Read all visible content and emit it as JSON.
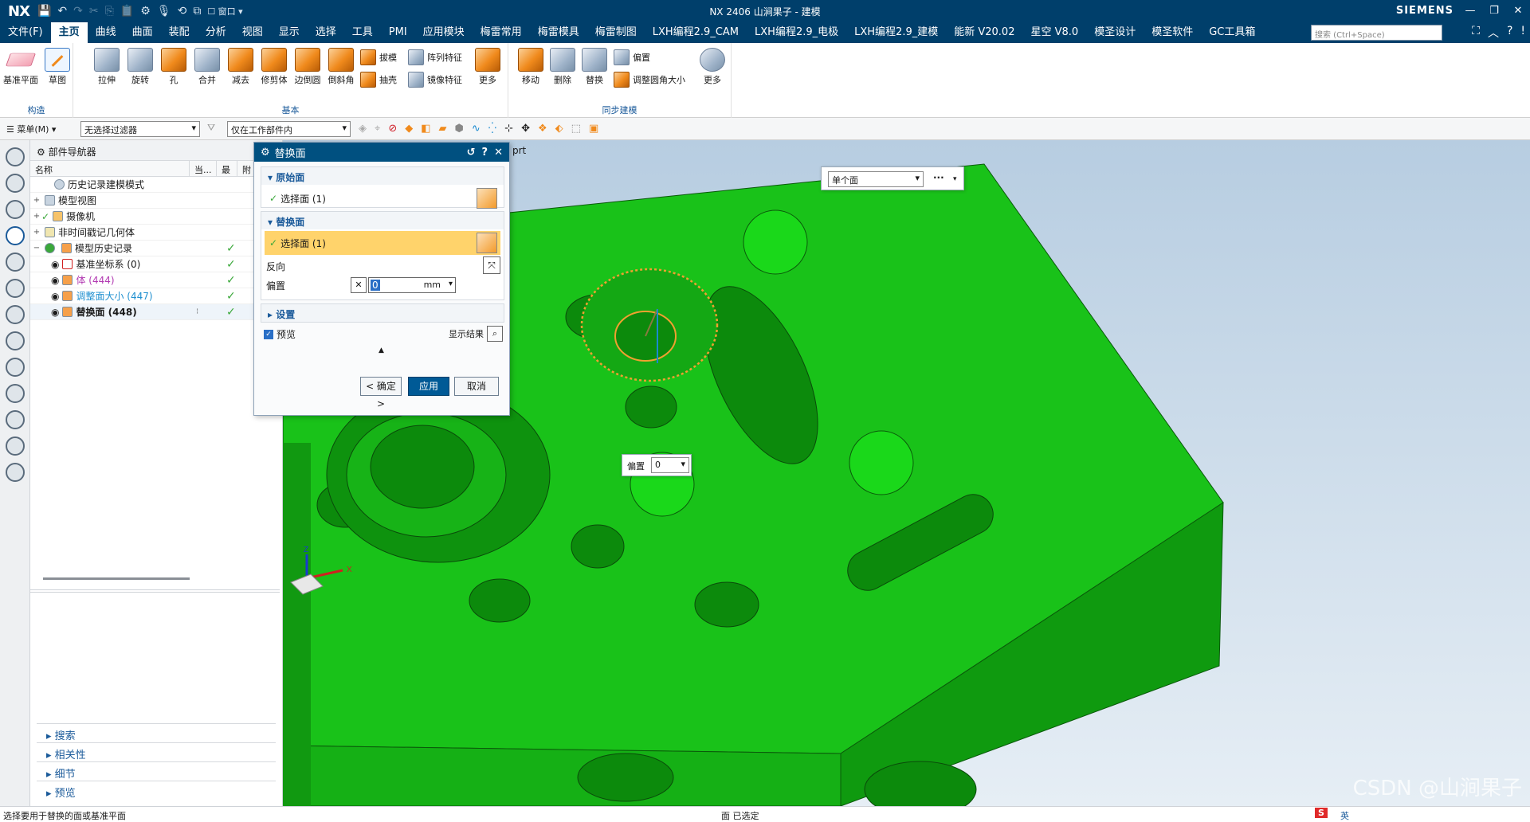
{
  "titlebar": {
    "logo": "NX",
    "window_menu": "窗口",
    "title": "NX 2406 山涧果子 - 建模",
    "brand": "SIEMENS"
  },
  "menubar": {
    "items": [
      "文件(F)",
      "主页",
      "曲线",
      "曲面",
      "装配",
      "分析",
      "视图",
      "显示",
      "选择",
      "工具",
      "PMI",
      "应用模块",
      "梅雷常用",
      "梅雷模具",
      "梅雷制图",
      "LXH编程2.9_CAM",
      "LXH编程2.9_电极",
      "LXH编程2.9_建模",
      "能新 V20.02",
      "星空 V8.0",
      "模圣设计",
      "模圣软件",
      "GC工具箱"
    ],
    "active": "主页",
    "search_placeholder": "搜索 (Ctrl+Space)"
  },
  "ribbon": {
    "construct": {
      "label": "构造",
      "tools": [
        "基准平面",
        "草图"
      ]
    },
    "basic": {
      "label": "基本",
      "tools": [
        "拉伸",
        "旋转",
        "孔",
        "合并",
        "减去",
        "修剪体",
        "边倒圆",
        "倒斜角"
      ],
      "small_tools": [
        "拔模",
        "抽壳",
        "阵列特征",
        "镜像特征"
      ],
      "more": "更多"
    },
    "sync": {
      "label": "同步建模",
      "tools": [
        "移动",
        "删除",
        "替换"
      ],
      "small_tools": [
        "偏置",
        "调整圆角大小"
      ],
      "more": "更多"
    }
  },
  "toolbar": {
    "menu_label": "菜单(M)",
    "filter": "无选择过滤器",
    "scope": "仅在工作部件内"
  },
  "navigator": {
    "title": "部件导航器",
    "columns": [
      "名称",
      "当...",
      "最",
      "附"
    ],
    "rows": [
      {
        "label": "历史记录建模模式"
      },
      {
        "label": "模型视图"
      },
      {
        "label": "摄像机"
      },
      {
        "label": "非时间戳记几何体"
      },
      {
        "label": "模型历史记录"
      },
      {
        "label": "基准坐标系 (0)"
      },
      {
        "label": "体 (444)"
      },
      {
        "label": "调整面大小 (447)"
      },
      {
        "label": "替换面 (448)"
      }
    ],
    "accordion": [
      "搜索",
      "相关性",
      "细节",
      "预览"
    ]
  },
  "viewport": {
    "tab_label": "prt",
    "selection_popup": {
      "value": "单个面",
      "more": "···"
    },
    "offset_popup": {
      "label": "偏置",
      "value": "0"
    },
    "watermark": "CSDN @山涧果子",
    "axis_x": "X",
    "axis_z": "Z",
    "colors": {
      "model": "#19c219",
      "model_dark": "#0f8f0f",
      "bg_top": "#b7cde1",
      "highlight": "#f0a030"
    }
  },
  "dialog": {
    "title": "替换面",
    "source_section": "原始面",
    "source_select": "选择面 (1)",
    "replace_section": "替换面",
    "replace_select": "选择面 (1)",
    "reverse_label": "反向",
    "offset_label": "偏置",
    "offset_value": "0",
    "offset_unit": "mm",
    "settings_section": "设置",
    "preview_label": "预览",
    "show_result_label": "显示结果",
    "ok_label": "< 确定 >",
    "apply_label": "应用",
    "cancel_label": "取消"
  },
  "status": {
    "hint": "选择要用于替换的面或基准平面",
    "selected": "面 已选定",
    "ime": "英"
  }
}
